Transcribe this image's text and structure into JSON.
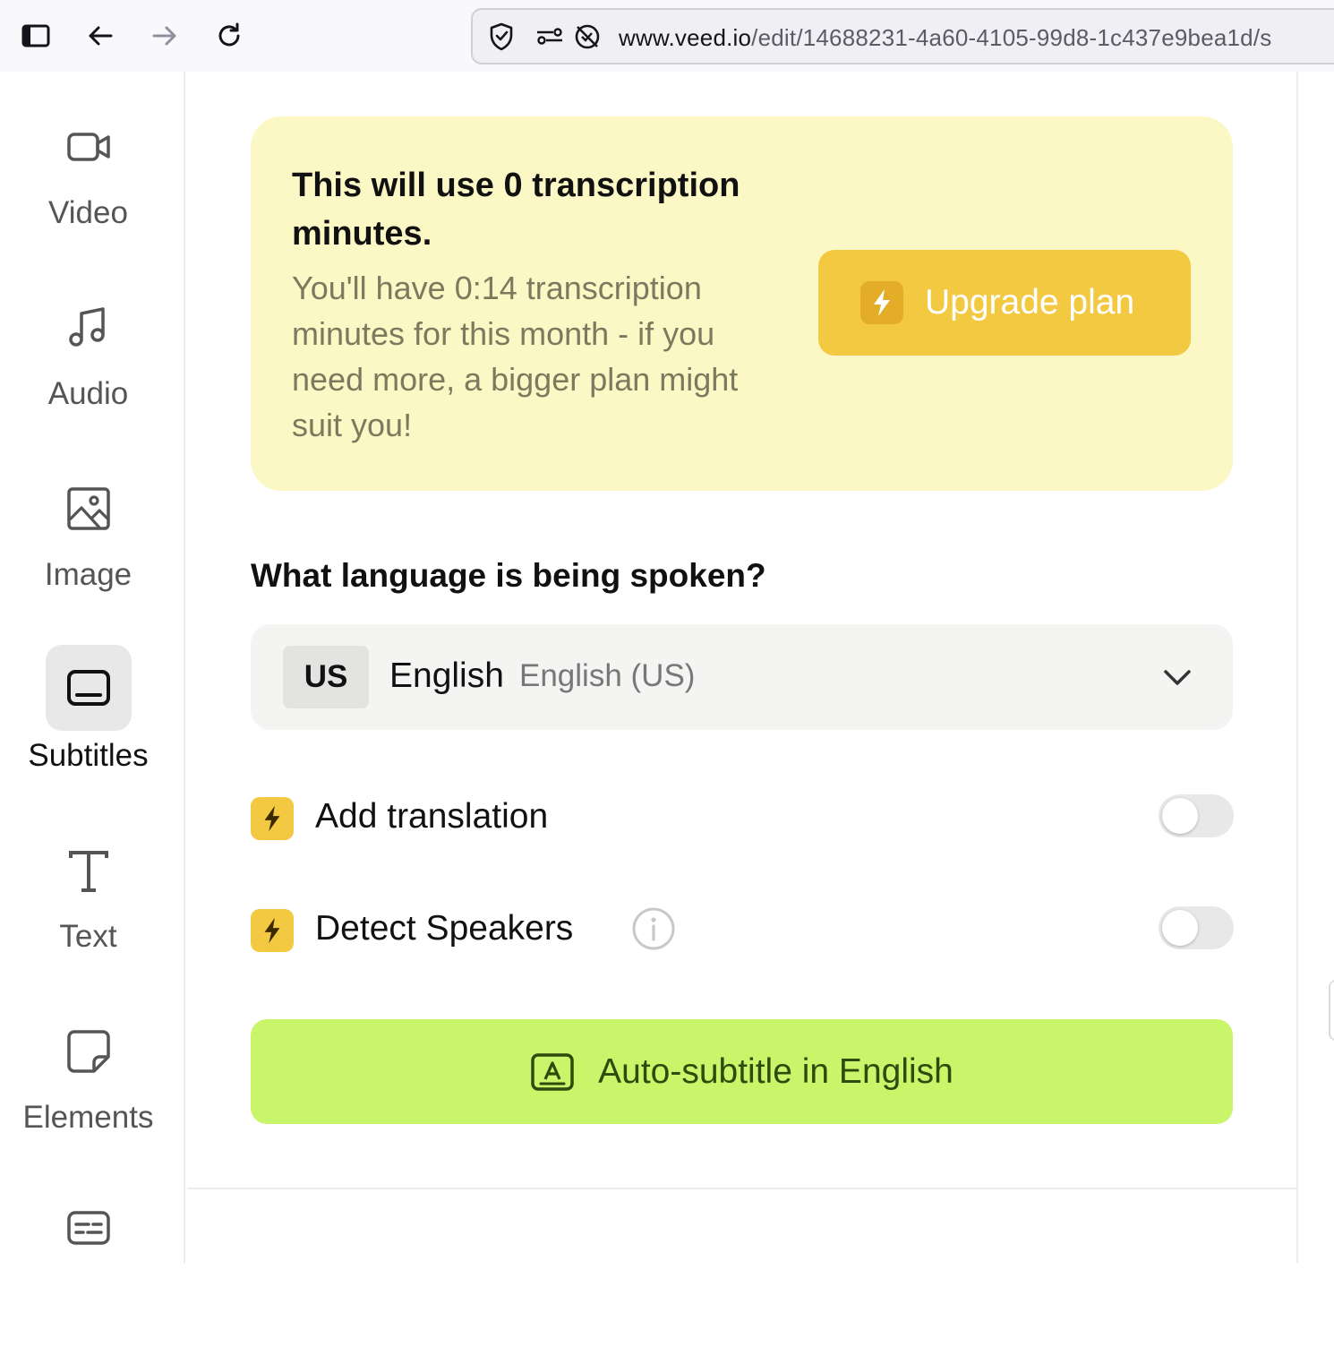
{
  "browser": {
    "url_host": "www.veed.io",
    "url_path": "/edit/14688231-4a60-4105-99d8-1c437e9bea1d/s",
    "icons": [
      "sidebar-toggle-icon",
      "back-arrow-icon",
      "forward-arrow-icon",
      "reload-icon",
      "shield-icon",
      "permissions-icon",
      "tracking-blocked-icon"
    ]
  },
  "sidebar": {
    "items": [
      {
        "label": "Video",
        "icon": "video-camera-icon",
        "active": false
      },
      {
        "label": "Audio",
        "icon": "music-note-icon",
        "active": false
      },
      {
        "label": "Image",
        "icon": "image-icon",
        "active": false
      },
      {
        "label": "Subtitles",
        "icon": "subtitles-icon",
        "active": true
      },
      {
        "label": "Text",
        "icon": "text-icon",
        "active": false
      },
      {
        "label": "Elements",
        "icon": "sticker-icon",
        "active": false
      },
      {
        "label": "",
        "icon": "captions-icon",
        "active": false
      }
    ]
  },
  "notice": {
    "title": "This will use 0 transcription minutes.",
    "body": "You'll have 0:14 transcription minutes for this month - if you need more, a bigger plan might suit you!",
    "upgrade_label": "Upgrade plan"
  },
  "language": {
    "question": "What language is being spoken?",
    "flag_code": "US",
    "selected": "English",
    "selected_variant": "English (US)"
  },
  "options": {
    "translation": {
      "label": "Add translation",
      "enabled": false
    },
    "speakers": {
      "label": "Detect Speakers",
      "enabled": false
    }
  },
  "action": {
    "label": "Auto-subtitle in English"
  },
  "colors": {
    "notice_bg": "#fcf8c6",
    "upgrade_bg": "#f4c942",
    "action_bg": "#c9f56a",
    "action_text": "#2e4a0c"
  }
}
